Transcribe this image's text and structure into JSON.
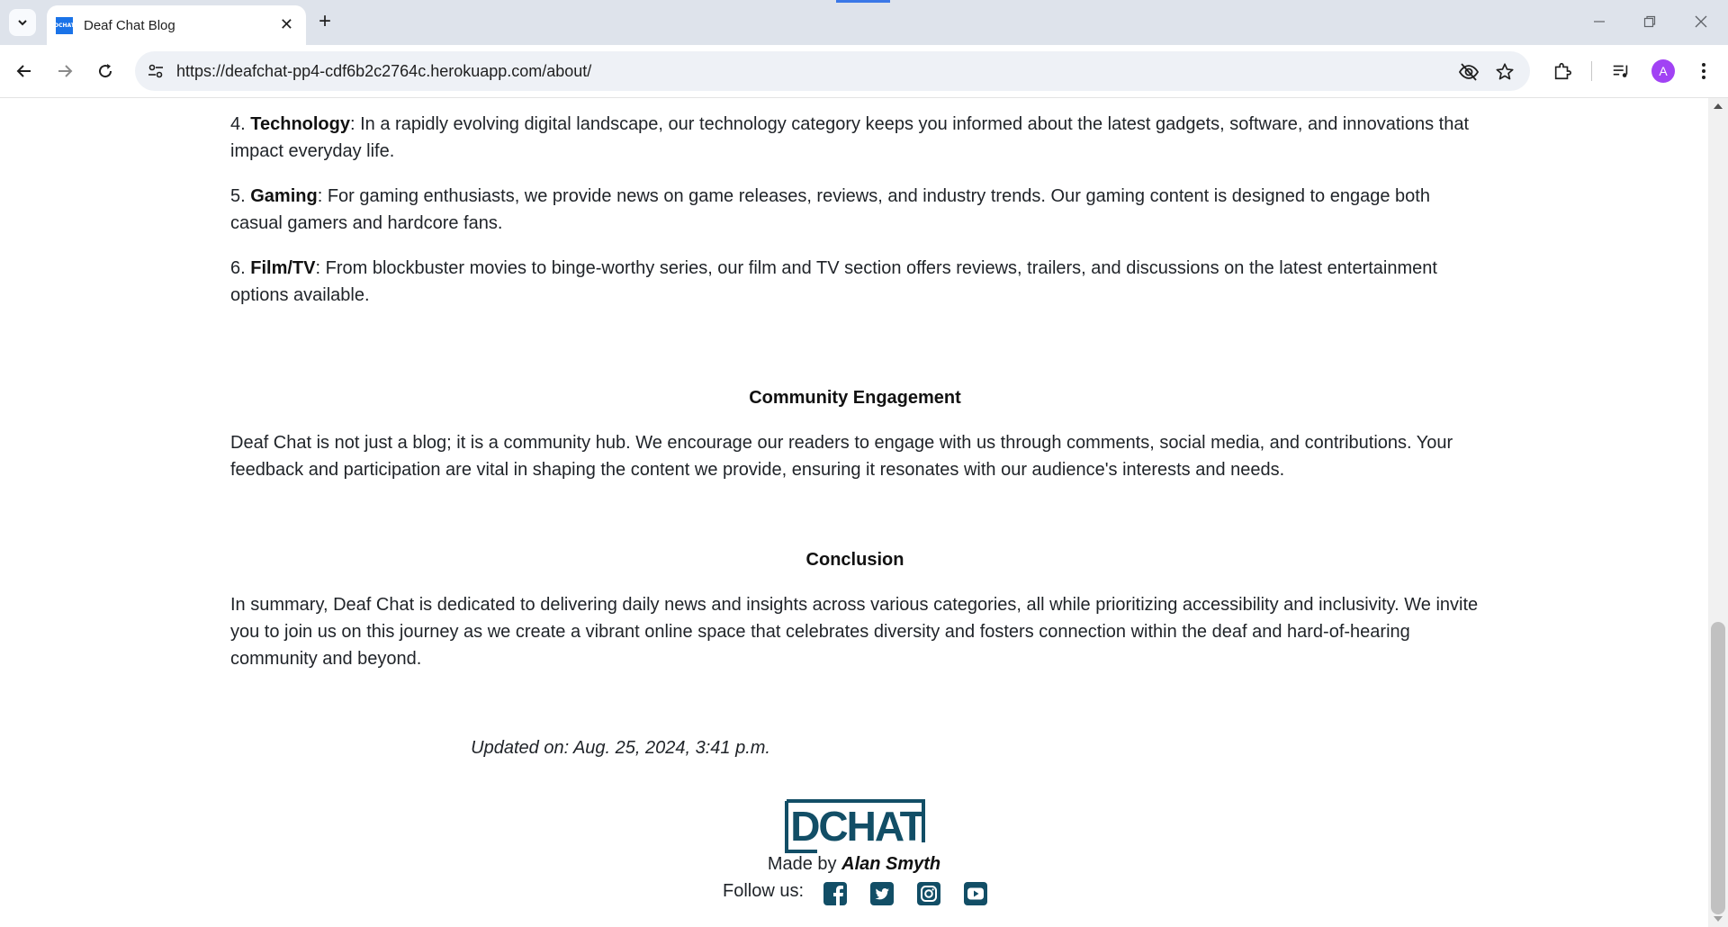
{
  "browser": {
    "tab_title": "Deaf Chat Blog",
    "favicon_text": "DCHAT",
    "url": "https://deafchat-pp4-cdf6b2c2764c.herokuapp.com/about/",
    "profile_initial": "A"
  },
  "article": {
    "items": [
      {
        "number": "4.",
        "term": "Technology",
        "text": ": In a rapidly evolving digital landscape, our technology category keeps you informed about the latest gadgets, software, and innovations that impact everyday life."
      },
      {
        "number": "5.",
        "term": "Gaming",
        "text": ": For gaming enthusiasts, we provide news on game releases, reviews, and industry trends. Our gaming content is designed to engage both casual gamers and hardcore fans."
      },
      {
        "number": "6.",
        "term": "Film/TV",
        "text": ": From blockbuster movies to binge-worthy series, our film and TV section offers reviews, trailers, and discussions on the latest entertainment options available."
      }
    ],
    "community_heading": "Community Engagement",
    "community_text": "Deaf Chat is not just a blog; it is a community hub. We encourage our readers to engage with us through comments, social media, and contributions. Your feedback and participation are vital in shaping the content we provide, ensuring it resonates with our audience's interests and needs.",
    "conclusion_heading": "Conclusion",
    "conclusion_text": "In summary, Deaf Chat is dedicated to delivering daily news and insights across various categories, all while prioritizing accessibility and inclusivity. We invite you to join us on this journey as we create a vibrant online space that celebrates diversity and fosters connection within the deaf and hard-of-hearing community and beyond.",
    "updated": "Updated on: Aug. 25, 2024, 3:41 p.m."
  },
  "footer": {
    "logo_text": "DCHAT",
    "made_by_prefix": "Made by",
    "author": "Alan Smyth",
    "follow_label": "Follow us:",
    "social": [
      "facebook-icon",
      "twitter-icon",
      "instagram-icon",
      "youtube-icon"
    ],
    "brand_color": "#124e66"
  }
}
